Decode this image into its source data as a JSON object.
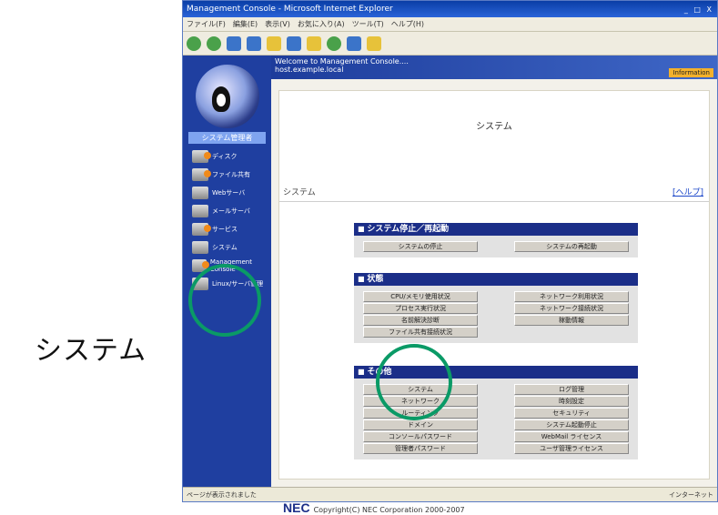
{
  "outer_label": "システム",
  "window": {
    "title": "Management Console - Microsoft Internet Explorer",
    "controls": "_ □ X",
    "menu": [
      "ファイル(F)",
      "編集(E)",
      "表示(V)",
      "お気に入り(A)",
      "ツール(T)",
      "ヘルプ(H)"
    ]
  },
  "sidebar": {
    "header": "システム管理者",
    "items": [
      {
        "label": "ディスク"
      },
      {
        "label": "ファイル共有"
      },
      {
        "label": "Webサーバ"
      },
      {
        "label": "メールサーバ"
      },
      {
        "label": "サービス"
      },
      {
        "label": "システム"
      },
      {
        "label": "Management Console"
      },
      {
        "label": "Linux/サーバ管理"
      }
    ]
  },
  "welcome": {
    "line1": "Welcome to Management Console....",
    "line2": "host.example.local",
    "info_label": "Information"
  },
  "page": {
    "title": "システム",
    "breadcrumb": "システム",
    "help": "[ヘルプ]"
  },
  "sections": [
    {
      "title": "システム停止／再起動",
      "buttons": [
        "システムの停止",
        "システムの再起動"
      ]
    },
    {
      "title": "状態",
      "buttons": [
        "CPU/メモリ使用状況",
        "ネットワーク利用状況",
        "プロセス実行状況",
        "ネットワーク接続状況",
        "名前解決診断",
        "稼動情報",
        "ファイル共有接続状況"
      ]
    },
    {
      "title": "その他",
      "buttons": [
        "システム",
        "ログ管理",
        "ネットワーク",
        "時刻設定",
        "ルーティング",
        "セキュリティ",
        "ドメイン",
        "システム起動停止",
        "コンソールパスワード",
        "WebMail ライセンス",
        "管理者パスワード",
        "ユーザ管理ライセンス"
      ]
    }
  ],
  "footer": {
    "brand": "NEC",
    "copyright": "Copyright(C) NEC Corporation 2000-2007"
  },
  "statusbar": {
    "left": "ページが表示されました",
    "right": "インターネット"
  }
}
